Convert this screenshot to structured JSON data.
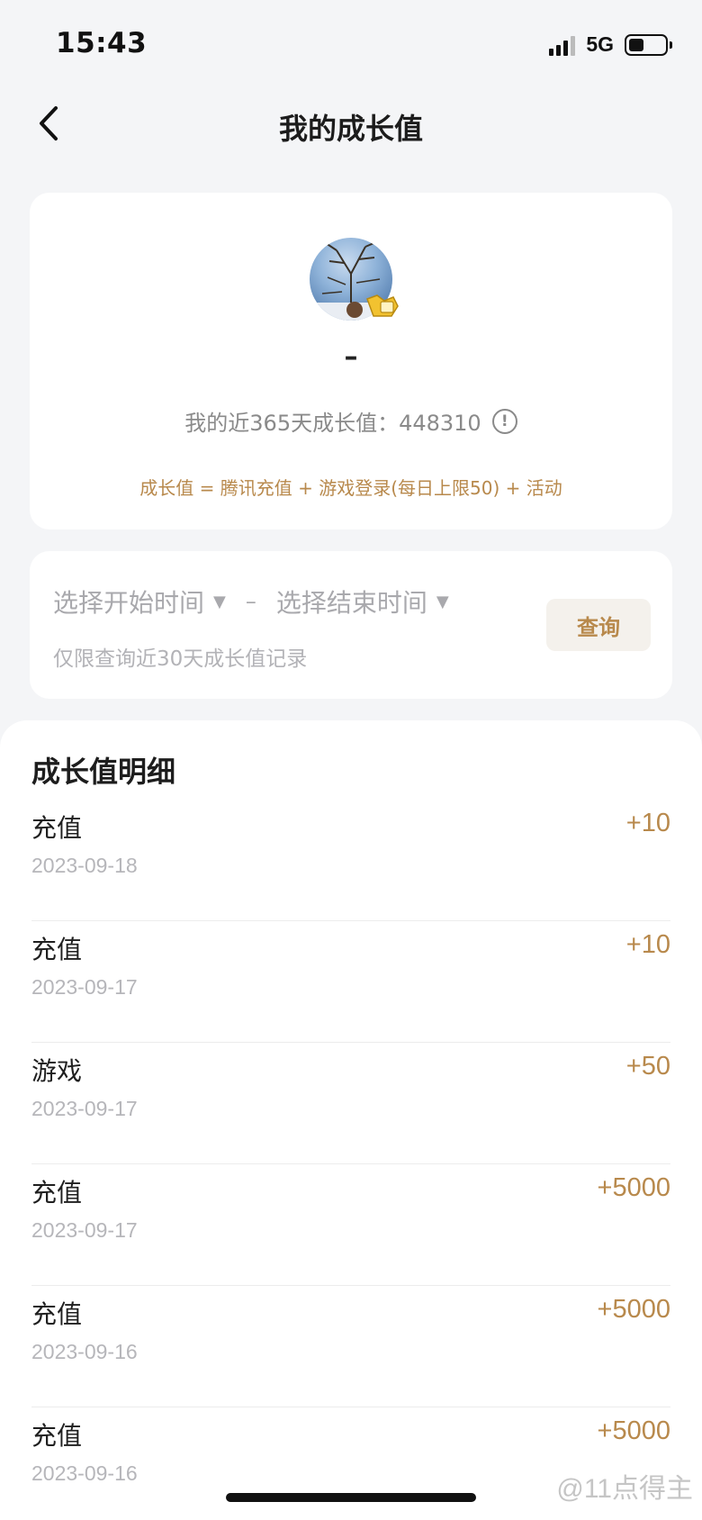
{
  "status_bar": {
    "time": "15:43",
    "network": "5G"
  },
  "nav": {
    "title": "我的成长值"
  },
  "profile": {
    "username": "–",
    "growth_label": "我的近365天成长值：448310",
    "formula": "成长值 = 腾讯充值 + 游戏登录(每日上限50) + 活动"
  },
  "filter": {
    "start_placeholder": "选择开始时间",
    "end_placeholder": "选择结束时间",
    "separator": "–",
    "hint": "仅限查询近30天成长值记录",
    "query_label": "查询"
  },
  "detail": {
    "title": "成长值明细",
    "records": [
      {
        "type": "充值",
        "date": "2023-09-18",
        "value": "+10"
      },
      {
        "type": "充值",
        "date": "2023-09-17",
        "value": "+10"
      },
      {
        "type": "游戏",
        "date": "2023-09-17",
        "value": "+50"
      },
      {
        "type": "充值",
        "date": "2023-09-17",
        "value": "+5000"
      },
      {
        "type": "充值",
        "date": "2023-09-16",
        "value": "+5000"
      },
      {
        "type": "充值",
        "date": "2023-09-16",
        "value": "+5000"
      }
    ]
  },
  "watermark": "@11点得主",
  "colors": {
    "accent": "#b8894c",
    "background": "#f4f5f7",
    "card": "#ffffff"
  },
  "icons": [
    "back-chevron-icon",
    "info-icon",
    "caret-down-icon",
    "signal-icon",
    "battery-icon",
    "vip-badge-icon"
  ]
}
